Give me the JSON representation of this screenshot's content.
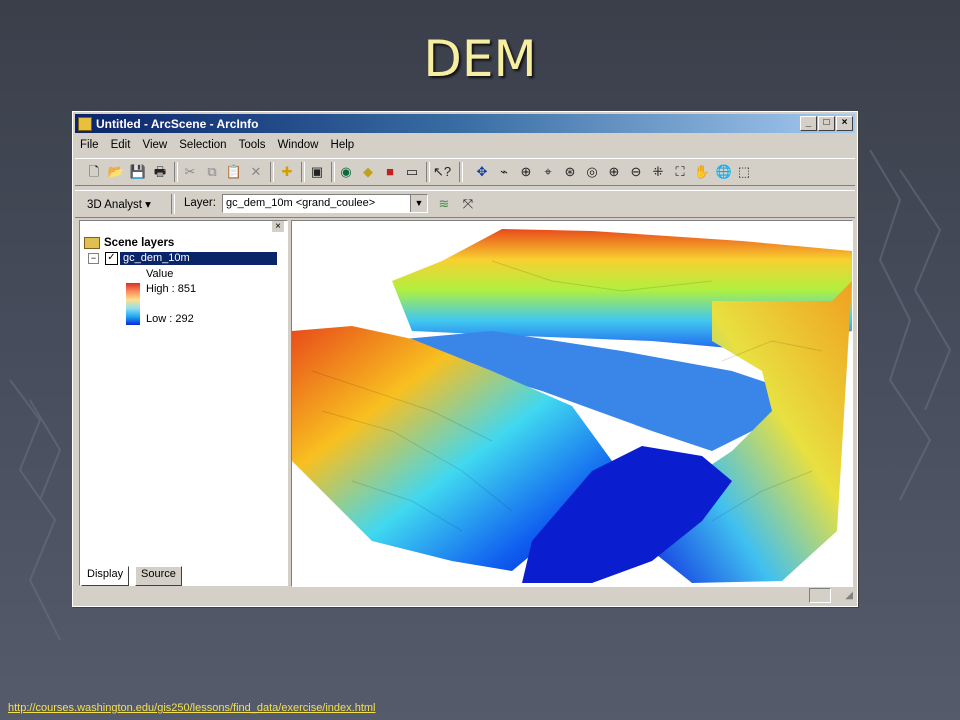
{
  "slide": {
    "title": "DEM",
    "source_url": "http://courses.washington.edu/gis250/lessons/find_data/exercise/index.html"
  },
  "window": {
    "title": "Untitled - ArcScene - ArcInfo",
    "controls": {
      "minimize": "_",
      "maximize": "□",
      "close": "×"
    }
  },
  "menu": [
    "File",
    "Edit",
    "View",
    "Selection",
    "Tools",
    "Window",
    "Help"
  ],
  "standard_toolbar": {
    "icons": [
      "new-icon",
      "open-icon",
      "save-icon",
      "print-icon",
      "cut-icon",
      "copy-icon",
      "paste-icon",
      "delete-icon",
      "add-data-icon",
      "scene-properties-icon",
      "arctoolbox-icon",
      "arccatalog-icon",
      "model-icon",
      "window-icon",
      "whats-this-icon",
      "navigate-icon",
      "fly-icon",
      "zoom-target-icon",
      "center-target-icon",
      "zoom-to-target-icon",
      "observer-icon",
      "zoom-in-icon",
      "zoom-out-icon",
      "narrow-fov-icon",
      "expand-fov-icon",
      "pan-icon",
      "full-extent-icon",
      "select-icon"
    ]
  },
  "analyst_toolbar": {
    "menu_label": "3D Analyst",
    "layer_label": "Layer:",
    "layer_value": "gc_dem_10m <grand_coulee>",
    "icons": [
      "contour-icon",
      "line-of-sight-icon"
    ]
  },
  "toc": {
    "root_label": "Scene layers",
    "layer_name": "gc_dem_10m",
    "layer_checked": true,
    "legend_title": "Value",
    "legend_high": "High : 851",
    "legend_low": "Low : 292",
    "tabs": [
      "Display",
      "Source"
    ],
    "active_tab": "Display"
  },
  "colors": {
    "elevation_high": "#d73027",
    "elevation_low": "#0a28d8",
    "title_text": "#f6eea0",
    "link_text": "#f4e04d",
    "title_bar": "#0a246a"
  }
}
